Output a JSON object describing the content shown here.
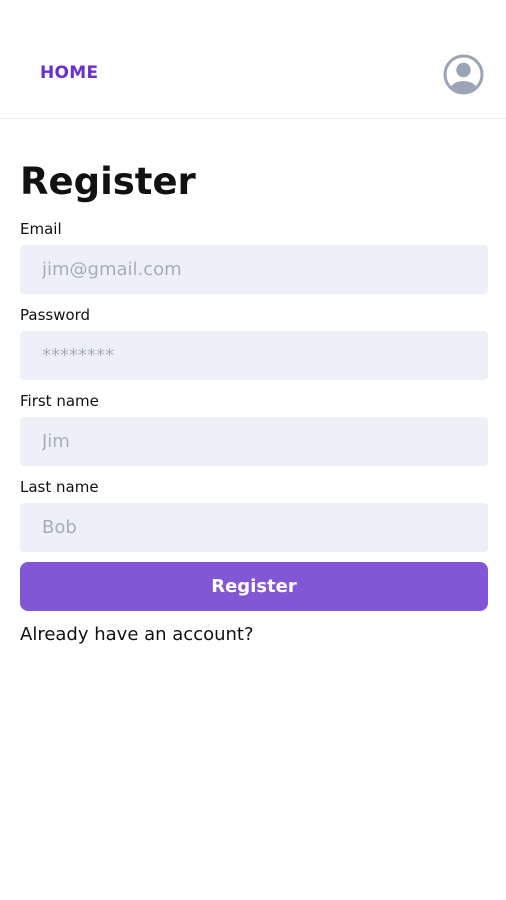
{
  "header": {
    "home_label": "HOME"
  },
  "form": {
    "title": "Register",
    "email": {
      "label": "Email",
      "placeholder": "jim@gmail.com"
    },
    "password": {
      "label": "Password",
      "placeholder": "********"
    },
    "first_name": {
      "label": "First name",
      "placeholder": "Jim"
    },
    "last_name": {
      "label": "Last name",
      "placeholder": "Bob"
    },
    "submit_label": "Register",
    "login_prompt": "Already have an account?"
  },
  "icons": {
    "avatar": "user-avatar-icon"
  },
  "colors": {
    "brand": "#6a2fd0",
    "button": "#8257d6",
    "input_bg": "#edf1f7",
    "placeholder": "#a5adbb",
    "avatar": "#9aa4b4"
  }
}
